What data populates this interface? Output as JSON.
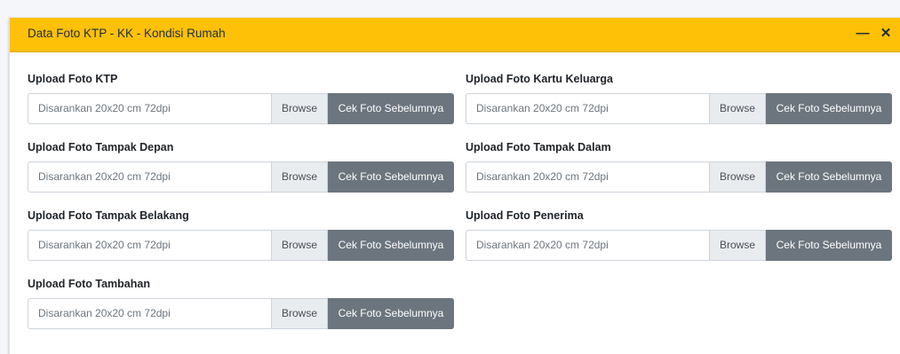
{
  "card": {
    "title": "Data Foto KTP - KK - Kondisi Rumah",
    "minimize_symbol": "—",
    "close_symbol": "✕"
  },
  "uploads": [
    {
      "label": "Upload Foto KTP",
      "placeholder": "Disarankan 20x20 cm 72dpi",
      "browse": "Browse",
      "button": "Cek Foto Sebelumnya"
    },
    {
      "label": "Upload Foto Kartu Keluarga",
      "placeholder": "Disarankan 20x20 cm 72dpi",
      "browse": "Browse",
      "button": "Cek Foto Sebelumnya"
    },
    {
      "label": "Upload Foto Tampak Depan",
      "placeholder": "Disarankan 20x20 cm 72dpi",
      "browse": "Browse",
      "button": "Cek Foto Sebelumnya"
    },
    {
      "label": "Upload Foto Tampak Dalam",
      "placeholder": "Disarankan 20x20 cm 72dpi",
      "browse": "Browse",
      "button": "Cek Foto Sebelumnya"
    },
    {
      "label": "Upload Foto Tampak Belakang",
      "placeholder": "Disarankan 20x20 cm 72dpi",
      "browse": "Browse",
      "button": "Cek Foto Sebelumnya"
    },
    {
      "label": "Upload Foto Penerima",
      "placeholder": "Disarankan 20x20 cm 72dpi",
      "browse": "Browse",
      "button": "Cek Foto Sebelumnya"
    },
    {
      "label": "Upload Foto Tambahan",
      "placeholder": "Disarankan 20x20 cm 72dpi",
      "browse": "Browse",
      "button": "Cek Foto Sebelumnya"
    }
  ],
  "colors": {
    "header_bg": "#ffc107",
    "button_bg": "#6c757d",
    "browse_bg": "#e9ecef"
  },
  "icons": {
    "minimize": "minus-icon",
    "close": "close-icon"
  }
}
